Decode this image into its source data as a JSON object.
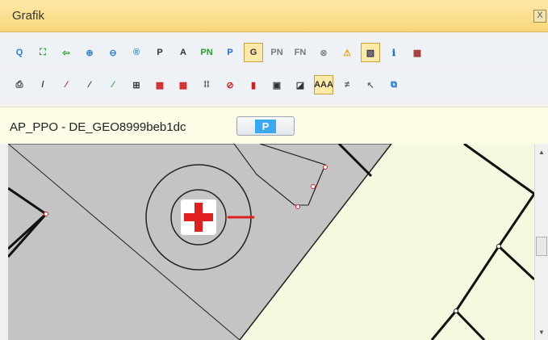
{
  "window": {
    "title": "Grafik",
    "close_symbol": "X"
  },
  "toolbar_row1": [
    {
      "icon": "zoom-all-icon",
      "glyph": "Q",
      "color": "#2a7fd0"
    },
    {
      "icon": "zoom-extent-icon",
      "glyph": "⛶",
      "color": "#2aa02a"
    },
    {
      "icon": "back-arrow-icon",
      "glyph": "⇦",
      "color": "#2aa02a"
    },
    {
      "icon": "zoom-in-icon",
      "glyph": "⊕",
      "color": "#2a7fd0"
    },
    {
      "icon": "zoom-out-icon",
      "glyph": "⊖",
      "color": "#2a7fd0"
    },
    {
      "icon": "zoom-r-icon",
      "glyph": "®",
      "color": "#2a7fd0"
    },
    {
      "icon": "frame-p-icon",
      "glyph": "P",
      "color": "#333"
    },
    {
      "icon": "frame-a-icon",
      "glyph": "A",
      "color": "#333"
    },
    {
      "icon": "pn-green-icon",
      "glyph": "PN",
      "color": "#2aa02a"
    },
    {
      "icon": "p-blue-icon",
      "glyph": "P",
      "color": "#1a6fd0"
    },
    {
      "icon": "g-icon",
      "glyph": "G",
      "color": "#333",
      "active": true
    },
    {
      "icon": "pn-gray-icon",
      "glyph": "PN",
      "color": "#777"
    },
    {
      "icon": "fn-gray-icon",
      "glyph": "FN",
      "color": "#777"
    },
    {
      "icon": "cancel-icon",
      "glyph": "⊗",
      "color": "#888"
    },
    {
      "icon": "warning-icon",
      "glyph": "⚠",
      "color": "#e0a000"
    },
    {
      "icon": "hatch-icon",
      "glyph": "▧",
      "color": "#335",
      "active": true
    },
    {
      "icon": "info-icon",
      "glyph": "ℹ",
      "color": "#1a6fd0"
    },
    {
      "icon": "dots-frame-icon",
      "glyph": "▦",
      "color": "#a03030"
    }
  ],
  "toolbar_row2": [
    {
      "icon": "print-icon",
      "glyph": "⎙",
      "color": "#333"
    },
    {
      "icon": "line-icon",
      "glyph": "/",
      "color": "#333"
    },
    {
      "icon": "line-remove-icon",
      "glyph": "⁄",
      "color": "#d02020"
    },
    {
      "icon": "line-cross-icon",
      "glyph": "⁄",
      "color": "#333"
    },
    {
      "icon": "line-add-icon",
      "glyph": "⁄",
      "color": "#2aa02a"
    },
    {
      "icon": "binoculars-icon",
      "glyph": "⊞",
      "color": "#333"
    },
    {
      "icon": "grid-red-icon",
      "glyph": "▦",
      "color": "#d02020"
    },
    {
      "icon": "grid-red2-icon",
      "glyph": "▦",
      "color": "#d02020"
    },
    {
      "icon": "dots-grid-icon",
      "glyph": "⁞⁞",
      "color": "#333"
    },
    {
      "icon": "no-draw-icon",
      "glyph": "⊘",
      "color": "#d02020"
    },
    {
      "icon": "traffic-light-icon",
      "glyph": "▮",
      "color": "#d02020"
    },
    {
      "icon": "point-icon",
      "glyph": "▣",
      "color": "#333"
    },
    {
      "icon": "contrast-icon",
      "glyph": "◪",
      "color": "#333"
    },
    {
      "icon": "text-aaa-icon",
      "glyph": "AAA",
      "color": "#333",
      "active": true
    },
    {
      "icon": "text-edit-icon",
      "glyph": "≠",
      "color": "#555"
    },
    {
      "icon": "pointer-icon",
      "glyph": "↖",
      "color": "#666"
    },
    {
      "icon": "copy-add-icon",
      "glyph": "⧉",
      "color": "#1a6fd0"
    }
  ],
  "infobar": {
    "label": "AP_PPO - DE_GEO8999beb1dc",
    "button_label": "P"
  },
  "colors": {
    "map_bg": "#f3fadf",
    "parcel": "#c4c4c4",
    "selection": "#e02020"
  }
}
